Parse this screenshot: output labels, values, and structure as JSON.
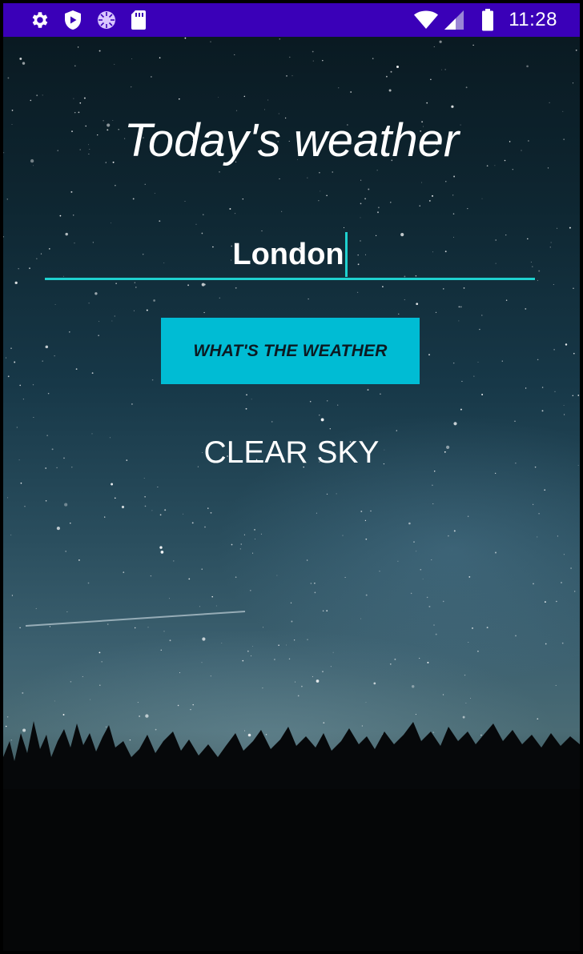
{
  "status_bar": {
    "time": "11:28",
    "background": "#3a00b8",
    "left_icons": [
      "gear-icon",
      "shield-play-icon",
      "sync-icon",
      "sd-card-icon"
    ],
    "right_icons": [
      "wifi-icon",
      "cell-signal-icon",
      "battery-icon"
    ]
  },
  "app": {
    "title": "Today's weather",
    "city_input": {
      "value": "London",
      "underline_color": "#1fd1cf"
    },
    "button": {
      "label": "WHAT'S THE WEATHER",
      "color": "#00bcd4"
    },
    "result": "CLEAR SKY"
  },
  "background": {
    "image": "night-sky-stars-forest"
  }
}
